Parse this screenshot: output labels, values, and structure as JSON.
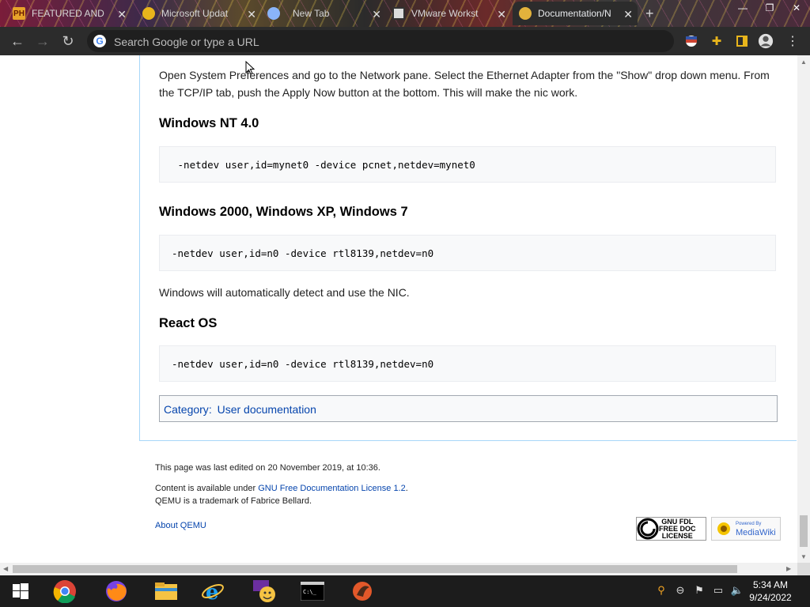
{
  "browser": {
    "tabs": [
      {
        "label": "FEATURED AND",
        "active": false
      },
      {
        "label": "Microsoft Updat",
        "active": false
      },
      {
        "label": "New Tab",
        "active": false
      },
      {
        "label": "VMware Workst",
        "active": false
      },
      {
        "label": "Documentation/N",
        "active": true
      }
    ],
    "address_placeholder": "Search Google or type a URL"
  },
  "article": {
    "intro": "Open System Preferences and go to the Network pane. Select the Ethernet Adapter from the \"Show\" drop down menu. From the TCP/IP tab, push the Apply Now button at the bottom. This will make the nic work.",
    "sections": [
      {
        "heading": "Windows NT 4.0",
        "code": " -netdev user,id=mynet0 -device pcnet,netdev=mynet0"
      },
      {
        "heading": "Windows 2000, Windows XP, Windows 7",
        "code": "-netdev user,id=n0 -device rtl8139,netdev=n0",
        "note": "Windows will automatically detect and use the NIC."
      },
      {
        "heading": "React OS",
        "code": "-netdev user,id=n0 -device rtl8139,netdev=n0"
      }
    ],
    "category_label": "Category",
    "category_link": "User documentation"
  },
  "footer": {
    "last_edited": "This page was last edited on 20 November 2019, at 10:36.",
    "content_prefix": "Content is available under ",
    "license_link": "GNU Free Documentation License 1.2",
    "content_suffix": ".",
    "trademark": "QEMU is a trademark of Fabrice Bellard.",
    "about_link": "About QEMU",
    "gfdl_badge": [
      "GNU FDL",
      "FREE DOC",
      "LICENSE"
    ],
    "mediawiki_badge": [
      "Powered By",
      "MediaWiki"
    ]
  },
  "taskbar": {
    "time": "5:34 AM",
    "date": "9/24/2022"
  },
  "colors": {
    "link": "#0645ad",
    "toolbar": "#2c2c2c",
    "taskbar": "#1c1c1c"
  }
}
